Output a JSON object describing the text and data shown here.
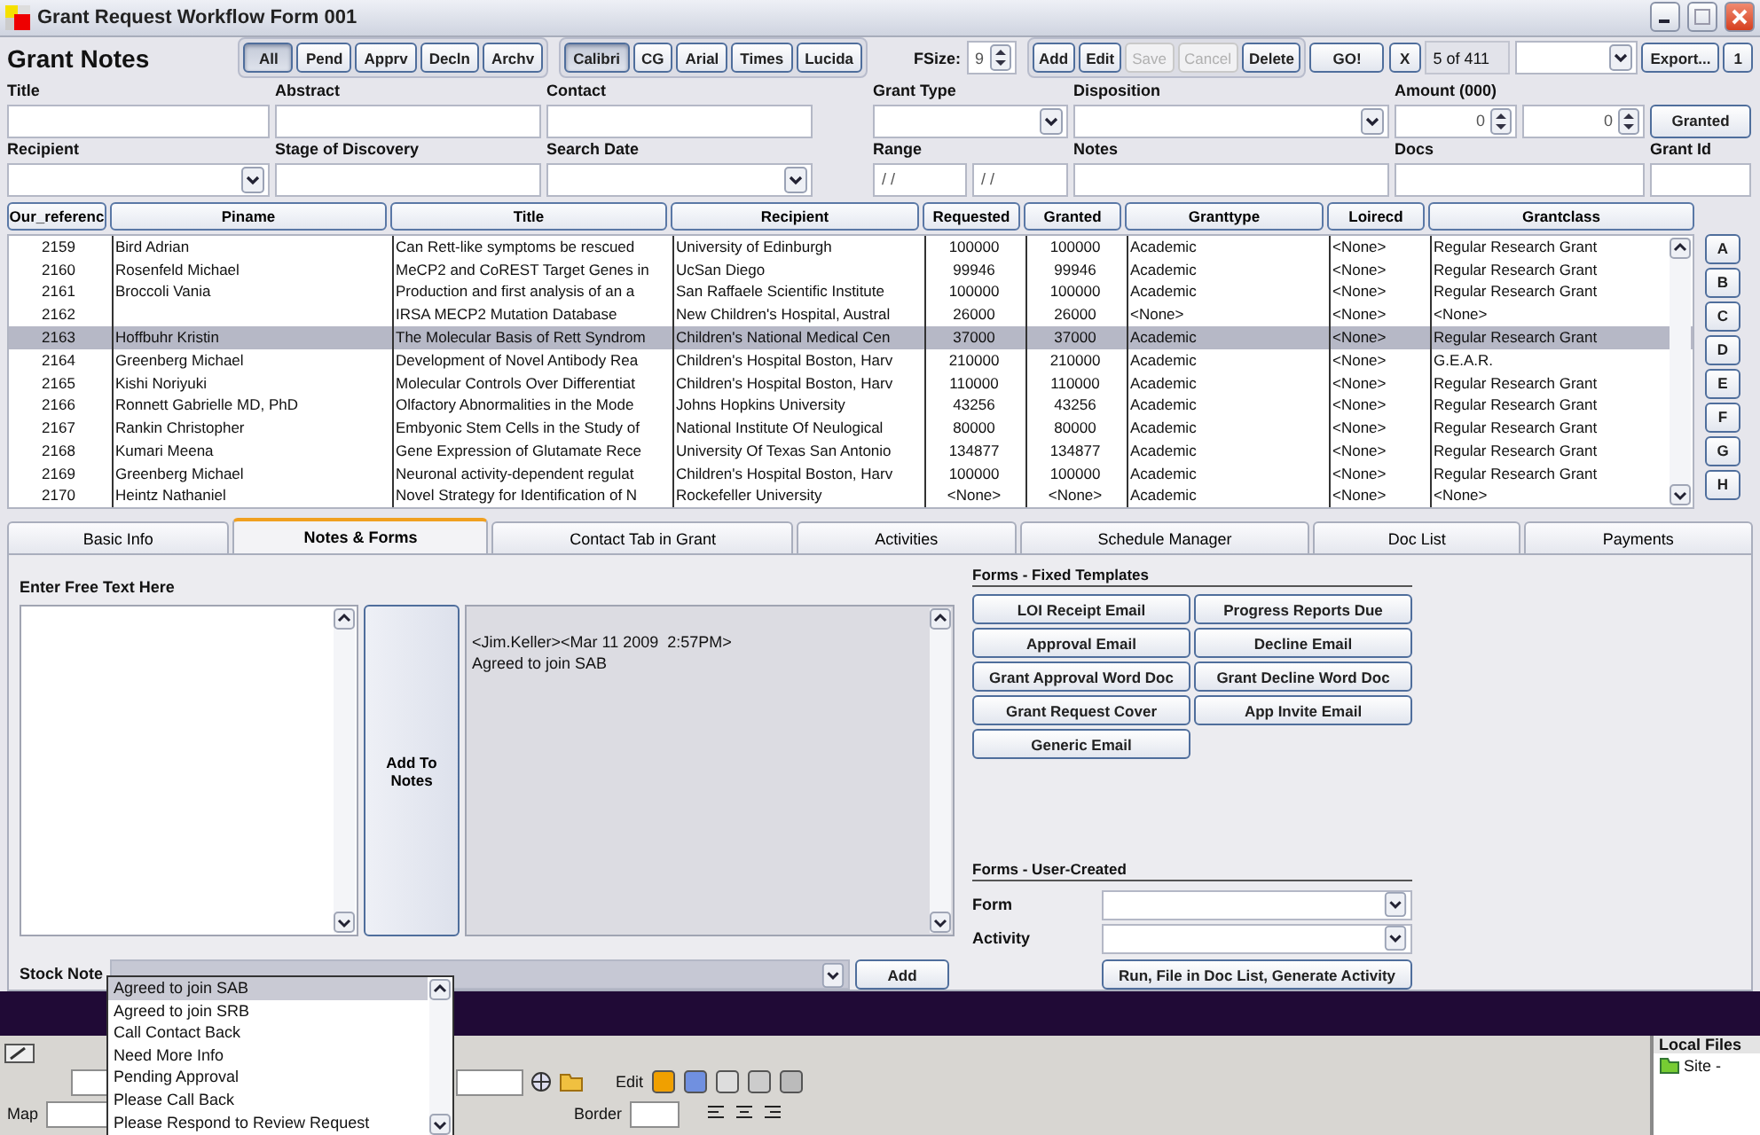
{
  "window": {
    "title": "Grant Request Workflow Form 001"
  },
  "heading": "Grant Notes",
  "status_filters": [
    {
      "label": "All",
      "selected": true
    },
    {
      "label": "Pend",
      "selected": false
    },
    {
      "label": "Apprv",
      "selected": false
    },
    {
      "label": "Decln",
      "selected": false
    },
    {
      "label": "Archv",
      "selected": false
    }
  ],
  "font_buttons": [
    {
      "label": "Calibri",
      "selected": true
    },
    {
      "label": "CG",
      "selected": false
    },
    {
      "label": "Arial",
      "selected": false
    },
    {
      "label": "Times",
      "selected": false
    },
    {
      "label": "Lucida",
      "selected": false
    }
  ],
  "font_size": {
    "label": "FSize:",
    "value": "9"
  },
  "record_buttons": [
    {
      "label": "Add",
      "disabled": false
    },
    {
      "label": "Edit",
      "disabled": false
    },
    {
      "label": "Save",
      "disabled": true
    },
    {
      "label": "Cancel",
      "disabled": true
    },
    {
      "label": "Delete",
      "disabled": false
    }
  ],
  "go_button": "GO!",
  "clear_button": "X",
  "record_counter": "5 of 411",
  "export_button": "Export...",
  "page_button": "1",
  "field_rows": [
    [
      {
        "kind": "text",
        "label": "Title"
      },
      {
        "kind": "text",
        "label": "Abstract"
      },
      {
        "kind": "text",
        "label": "Contact"
      },
      {
        "kind": "combo",
        "label": "Grant Type"
      },
      {
        "kind": "combo",
        "label": "Disposition"
      },
      {
        "kind": "spinners",
        "label": "Amount (000)",
        "values": [
          "0",
          "0"
        ]
      },
      {
        "kind": "button",
        "label": "Granted"
      }
    ],
    [
      {
        "kind": "combo",
        "label": "Recipient"
      },
      {
        "kind": "text",
        "label": "Stage of Discovery"
      },
      {
        "kind": "combo",
        "label": "Search Date"
      },
      {
        "kind": "range",
        "label": "Range",
        "values": [
          "/ /",
          "/ /"
        ]
      },
      {
        "kind": "text",
        "label": "Notes"
      },
      {
        "kind": "text",
        "label": "Docs"
      },
      {
        "kind": "text",
        "label": "Grant Id"
      }
    ]
  ],
  "table": {
    "columns": [
      "Our_referenc",
      "Piname",
      "Title",
      "Recipient",
      "Requested",
      "Granted",
      "Granttype",
      "Loirecd",
      "Grantclass"
    ],
    "rows": [
      {
        "selected": false,
        "cells": [
          "2159",
          "Bird Adrian",
          "Can Rett-like symptoms be rescued",
          "University of Edinburgh",
          "100000",
          "100000",
          "Academic",
          "<None>",
          "Regular Research Grant"
        ]
      },
      {
        "selected": false,
        "cells": [
          "2160",
          "Rosenfeld Michael",
          "MeCP2 and CoREST Target Genes in",
          "UcSan Diego",
          "99946",
          "99946",
          "Academic",
          "<None>",
          "Regular Research Grant"
        ]
      },
      {
        "selected": false,
        "cells": [
          "2161",
          "Broccoli Vania",
          "Production and first analysis of an a",
          "San Raffaele Scientific Institute",
          "100000",
          "100000",
          "Academic",
          "<None>",
          "Regular Research Grant"
        ]
      },
      {
        "selected": false,
        "cells": [
          "2162",
          null,
          "IRSA MECP2 Mutation Database",
          "New Children's Hospital, Austral",
          "26000",
          "26000",
          "<None>",
          "<None>",
          "<None>"
        ]
      },
      {
        "selected": true,
        "cells": [
          "2163",
          "Hoffbuhr Kristin",
          "The Molecular Basis of Rett Syndrom",
          "Children's National Medical Cen",
          "37000",
          "37000",
          "Academic",
          "<None>",
          "Regular Research Grant"
        ]
      },
      {
        "selected": false,
        "cells": [
          "2164",
          "Greenberg Michael",
          "Development of Novel Antibody Rea",
          "Children's Hospital Boston, Harv",
          "210000",
          "210000",
          "Academic",
          "<None>",
          "G.E.A.R."
        ]
      },
      {
        "selected": false,
        "cells": [
          "2165",
          "Kishi Noriyuki",
          "Molecular Controls Over Differentiat",
          "Children's Hospital Boston, Harv",
          "110000",
          "110000",
          "Academic",
          "<None>",
          "Regular Research Grant"
        ]
      },
      {
        "selected": false,
        "cells": [
          "2166",
          "Ronnett Gabrielle MD, PhD",
          "Olfactory Abnormalities in the Mode",
          "Johns Hopkins University",
          "43256",
          "43256",
          "Academic",
          "<None>",
          "Regular Research Grant"
        ]
      },
      {
        "selected": false,
        "cells": [
          "2167",
          "Rankin Christopher",
          "Embyonic Stem Cells in the Study of",
          "National Institute Of Neulogical",
          "80000",
          "80000",
          "Academic",
          "<None>",
          "Regular Research Grant"
        ]
      },
      {
        "selected": false,
        "cells": [
          "2168",
          "Kumari Meena",
          "Gene Expression of Glutamate Rece",
          "University Of Texas San Antonio",
          "134877",
          "134877",
          "Academic",
          "<None>",
          "Regular Research Grant"
        ]
      },
      {
        "selected": false,
        "cells": [
          "2169",
          "Greenberg Michael",
          "Neuronal activity-dependent regulat",
          "Children's Hospital Boston, Harv",
          "100000",
          "100000",
          "Academic",
          "<None>",
          "Regular Research Grant"
        ]
      },
      {
        "selected": false,
        "cells": [
          "2170",
          "Heintz Nathaniel",
          "Novel Strategy for Identification of N",
          "Rockefeller University",
          "<None>",
          "<None>",
          "Academic",
          "<None>",
          "<None>"
        ]
      }
    ]
  },
  "letter_buttons": [
    "A",
    "B",
    "C",
    "D",
    "E",
    "F",
    "G",
    "H"
  ],
  "tabs": [
    {
      "label": "Basic Info",
      "selected": false
    },
    {
      "label": "Notes & Forms",
      "selected": true
    },
    {
      "label": "Contact Tab in Grant",
      "selected": false
    },
    {
      "label": "Activities",
      "selected": false
    },
    {
      "label": "Schedule Manager",
      "selected": false
    },
    {
      "label": "Doc List",
      "selected": false
    },
    {
      "label": "Payments",
      "selected": false
    }
  ],
  "free_text": {
    "label": "Enter Free Text Here",
    "add_button": "Add To Notes"
  },
  "notes_log": [
    "<Jim.Keller><Mar 11 2009  2:57PM>",
    "Agreed to join SAB"
  ],
  "fixed_templates": {
    "title": "Forms - Fixed Templates",
    "buttons": [
      "LOI Receipt Email",
      "Progress Reports Due",
      "Approval Email",
      "Decline Email",
      "Grant Approval Word Doc",
      "Grant Decline Word Doc",
      "Grant Request Cover",
      "App Invite Email",
      "Generic Email"
    ]
  },
  "user_created": {
    "title": "Forms - User-Created",
    "fields": [
      "Form",
      "Activity"
    ],
    "run_button": "Run, File in Doc List, Generate Activity"
  },
  "stock_note": {
    "label": "Stock Note",
    "add_button": "Add",
    "options": [
      {
        "label": "Agreed to join SAB",
        "selected": true
      },
      {
        "label": "Agreed to join SRB",
        "selected": false
      },
      {
        "label": "Call Contact Back",
        "selected": false
      },
      {
        "label": "Need More Info",
        "selected": false
      },
      {
        "label": "Pending Approval",
        "selected": false
      },
      {
        "label": "Please Call Back",
        "selected": false
      },
      {
        "label": "Please Respond to Review Request",
        "selected": false
      }
    ]
  },
  "background_window": {
    "edit_label": "Edit",
    "map_label": "Map",
    "border_label": "Border",
    "panel_title": "Local Files",
    "tree_item": "Site -"
  }
}
